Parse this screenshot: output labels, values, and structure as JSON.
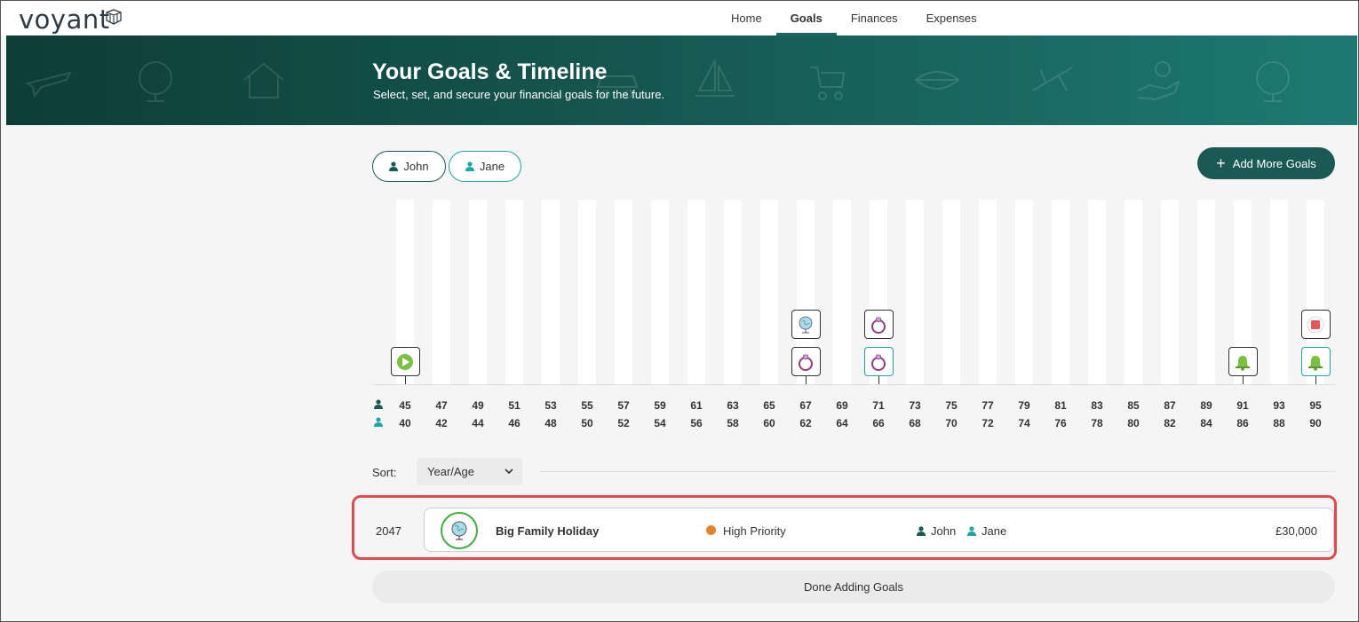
{
  "brand": {
    "logo_text": "voyant"
  },
  "nav": {
    "items": [
      {
        "label": "Home"
      },
      {
        "label": "Goals",
        "active": true
      },
      {
        "label": "Finances"
      },
      {
        "label": "Expenses"
      }
    ]
  },
  "hero": {
    "title": "Your Goals & Timeline",
    "subtitle": "Select, set, and secure your financial goals for the future."
  },
  "people": {
    "john": {
      "label": "John",
      "color": "#1b5a54"
    },
    "jane": {
      "label": "Jane",
      "color": "#1ca6a6"
    }
  },
  "add_goals_label": "Add More Goals",
  "timeline": {
    "john_ages": [
      "45",
      "47",
      "49",
      "51",
      "53",
      "55",
      "57",
      "59",
      "61",
      "63",
      "65",
      "67",
      "69",
      "71",
      "73",
      "75",
      "77",
      "79",
      "81",
      "83",
      "85",
      "87",
      "89",
      "91",
      "93",
      "95"
    ],
    "jane_ages": [
      "40",
      "42",
      "44",
      "46",
      "48",
      "50",
      "52",
      "54",
      "56",
      "58",
      "60",
      "62",
      "64",
      "66",
      "68",
      "70",
      "72",
      "74",
      "76",
      "78",
      "80",
      "82",
      "84",
      "86",
      "88",
      "90"
    ],
    "markers": [
      {
        "icon": "play-icon",
        "col": 0,
        "owner": "john",
        "level": 0
      },
      {
        "icon": "globe-icon",
        "col": 11,
        "owner": "john",
        "level": 1
      },
      {
        "icon": "ring-icon",
        "col": 11,
        "owner": "john",
        "level": 0
      },
      {
        "icon": "ring-icon",
        "col": 13,
        "owner": "john",
        "level": 1
      },
      {
        "icon": "ring-icon",
        "col": 13,
        "owner": "jane",
        "level": 0
      },
      {
        "icon": "bell-icon",
        "col": 23,
        "owner": "john",
        "level": 0
      },
      {
        "icon": "stop-icon",
        "col": 25,
        "owner": "john",
        "level": 1
      },
      {
        "icon": "bell-icon",
        "col": 25,
        "owner": "jane",
        "level": 0
      }
    ]
  },
  "sort": {
    "label": "Sort:",
    "value": "Year/Age"
  },
  "goal": {
    "year": "2047",
    "name": "Big Family Holiday",
    "priority": "High Priority",
    "priority_color": "#e8822a",
    "owners": [
      "John",
      "Jane"
    ],
    "amount": "£30,000",
    "icon": "globe-icon"
  },
  "done_label": "Done Adding Goals",
  "colors": {
    "accent": "#1b5a54",
    "highlight": "#e04a4e",
    "teal": "#1ca6a6"
  }
}
